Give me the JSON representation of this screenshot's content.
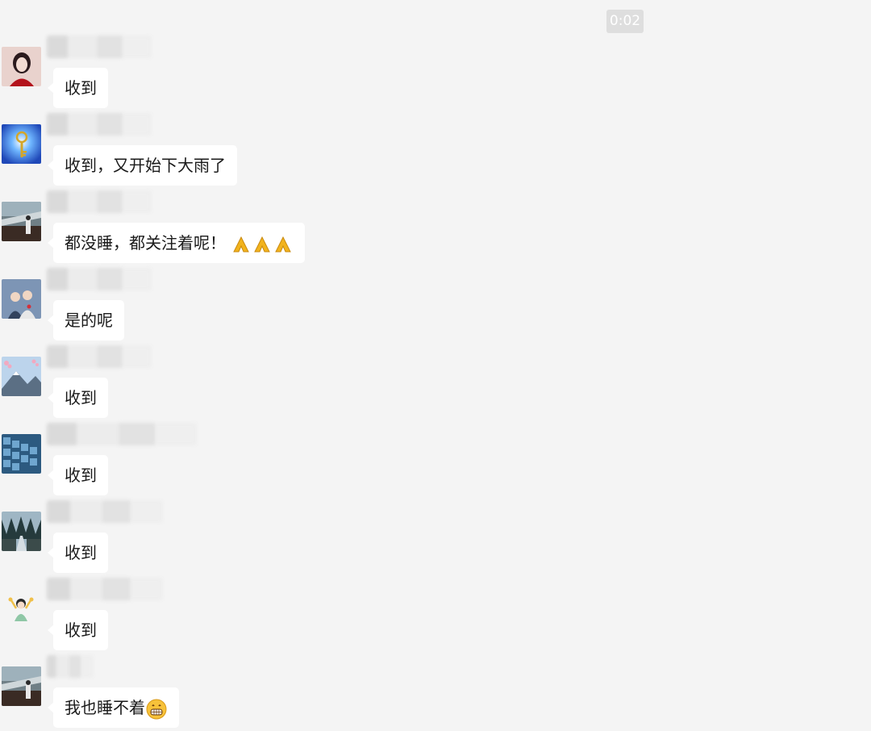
{
  "chat": {
    "timestamp": "0:02",
    "messages": [
      {
        "avatar_icon": "woman-portrait-avatar-icon",
        "sender": "",
        "text": "收到",
        "emojis": []
      },
      {
        "avatar_icon": "golden-key-avatar-icon",
        "sender": "",
        "text": "收到，又开始下大雨了",
        "emojis": []
      },
      {
        "avatar_icon": "person-landscape-avatar-icon",
        "sender": "",
        "text": "都没睡，都关注着呢！",
        "emojis": [
          "praying-hands-emoji",
          "praying-hands-emoji",
          "praying-hands-emoji"
        ]
      },
      {
        "avatar_icon": "couple-illustration-avatar-icon",
        "sender": "",
        "text": "是的呢",
        "emojis": []
      },
      {
        "avatar_icon": "mountain-blossom-avatar-icon",
        "sender": "",
        "text": "收到",
        "emojis": []
      },
      {
        "avatar_icon": "building-blocks-avatar-icon",
        "sender": "",
        "text": "收到",
        "emojis": []
      },
      {
        "avatar_icon": "forest-road-avatar-icon",
        "sender": "",
        "text": "收到",
        "emojis": []
      },
      {
        "avatar_icon": "cartoon-kids-avatar-icon",
        "sender": "",
        "text": "收到",
        "emojis": []
      },
      {
        "avatar_icon": "person-landscape-avatar-icon",
        "sender": "",
        "text": "我也睡不着",
        "emojis": [
          "grinning-face-emoji"
        ]
      }
    ]
  },
  "colors": {
    "background": "#f4f4f4",
    "bubble": "#ffffff",
    "text": "#1a1a1a",
    "timestamp_bg": "#dedede"
  }
}
